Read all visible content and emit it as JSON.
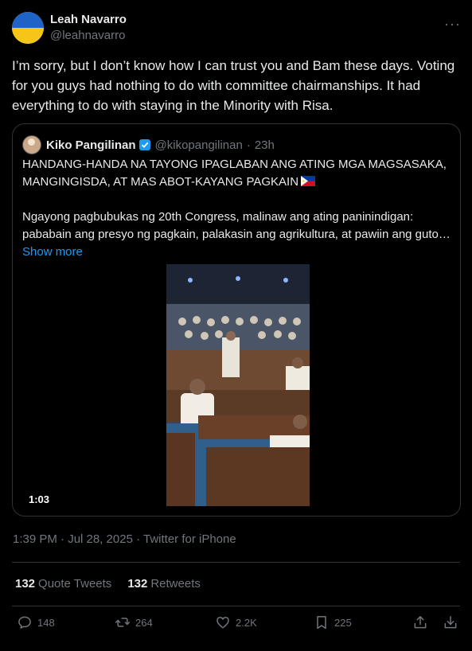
{
  "tweet": {
    "author": {
      "display_name": "Leah Navarro",
      "handle": "@leahnavarro"
    },
    "text": "I’m sorry, but I don’t know how I can trust you and Bam these days. Voting for you guys had nothing to do with committee chairmanships. It had everything to do with staying in the Minority with Risa.",
    "more_label": "···"
  },
  "quote": {
    "display_name": "Kiko Pangilinan",
    "handle": "@kikopangilinan",
    "separator": "·",
    "time": "23h",
    "headline": "HANDANG-HANDA NA TAYONG IPAGLABAN ANG ATING MGA MAGSASAKA, MANGINGISDA, AT MAS ABOT-KAYANG PAGKAIN",
    "body": "Ngayong pagbubukas ng 20th Congress, malinaw ang ating paninindigan: pababain ang presyo ng pagkain, palakasin ang agrikultura, at pawiin ang guto…",
    "show_more": "Show more",
    "video_duration": "1:03"
  },
  "meta": {
    "timestamp": "1:39 PM · Jul 28, 2025 · Twitter for iPhone"
  },
  "stats": {
    "quote_count": "132",
    "quote_label": "Quote Tweets",
    "retweet_count": "132",
    "retweet_label": "Retweets"
  },
  "actions": {
    "replies": "148",
    "retweets": "264",
    "likes": "2.2K",
    "bookmarks": "225"
  },
  "colors": {
    "accent": "#1d9bf0",
    "muted": "#71767b",
    "text": "#e7e9ea",
    "border": "#2f3336",
    "background": "#000000"
  }
}
